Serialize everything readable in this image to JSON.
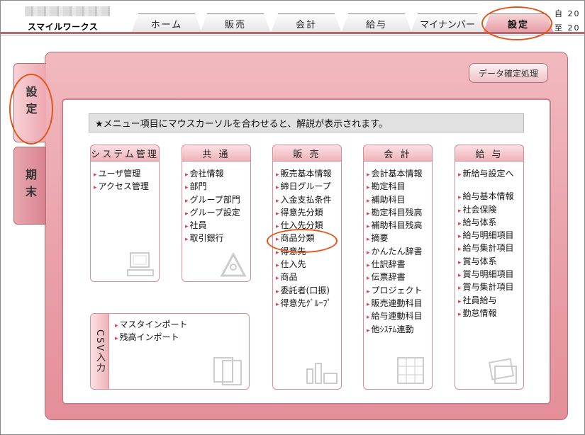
{
  "app": {
    "name": "スマイルワークス"
  },
  "tabs": [
    "ホーム",
    "販売",
    "会計",
    "給与",
    "マイナンバー",
    "設定"
  ],
  "corner": [
    "自 20",
    "至 20"
  ],
  "side_tabs": {
    "active": "設定",
    "inactive": "期末"
  },
  "confirm_button": "データ確定処理",
  "info_text": "★メニュー項目にマウスカーソルを合わせると、解説が表示されます。",
  "panels": {
    "system": {
      "title": "システム管理",
      "items": [
        "ユーザ管理",
        "アクセス管理"
      ]
    },
    "common": {
      "title": "共 通",
      "items": [
        "会社情報",
        "部門",
        "グループ部門",
        "グループ設定",
        "社員",
        "取引銀行"
      ]
    },
    "sales": {
      "title": "販 売",
      "items": [
        "販売基本情報",
        "締日グループ",
        "入金支払条件",
        "得意先分類",
        "仕入先分類",
        "商品分類",
        "得意先",
        "仕入先",
        "商品",
        "委託者(口振)",
        "得意先ｸﾞﾙｰﾌﾟ"
      ]
    },
    "accounting": {
      "title": "会 計",
      "items": [
        "会計基本情報",
        "勘定科目",
        "補助科目",
        "勘定科目残高",
        "補助科目残高",
        "摘要",
        "かんたん辞書",
        "仕訳辞書",
        "伝票辞書",
        "プロジェクト",
        "販売連動科目",
        "給与連動科目",
        "他ｼｽﾃﾑ連動"
      ]
    },
    "payroll": {
      "title": "給 与",
      "items": [
        "新給与設定へ",
        "給与基本情報",
        "社会保険",
        "給与体系",
        "給与明細項目",
        "給与集計項目",
        "賞与体系",
        "賞与明細項目",
        "賞与集計項目",
        "社員給与",
        "勤怠情報"
      ]
    }
  },
  "csv": {
    "title": "CSV入力",
    "items": [
      "マスタインポート",
      "残高インポート"
    ]
  }
}
